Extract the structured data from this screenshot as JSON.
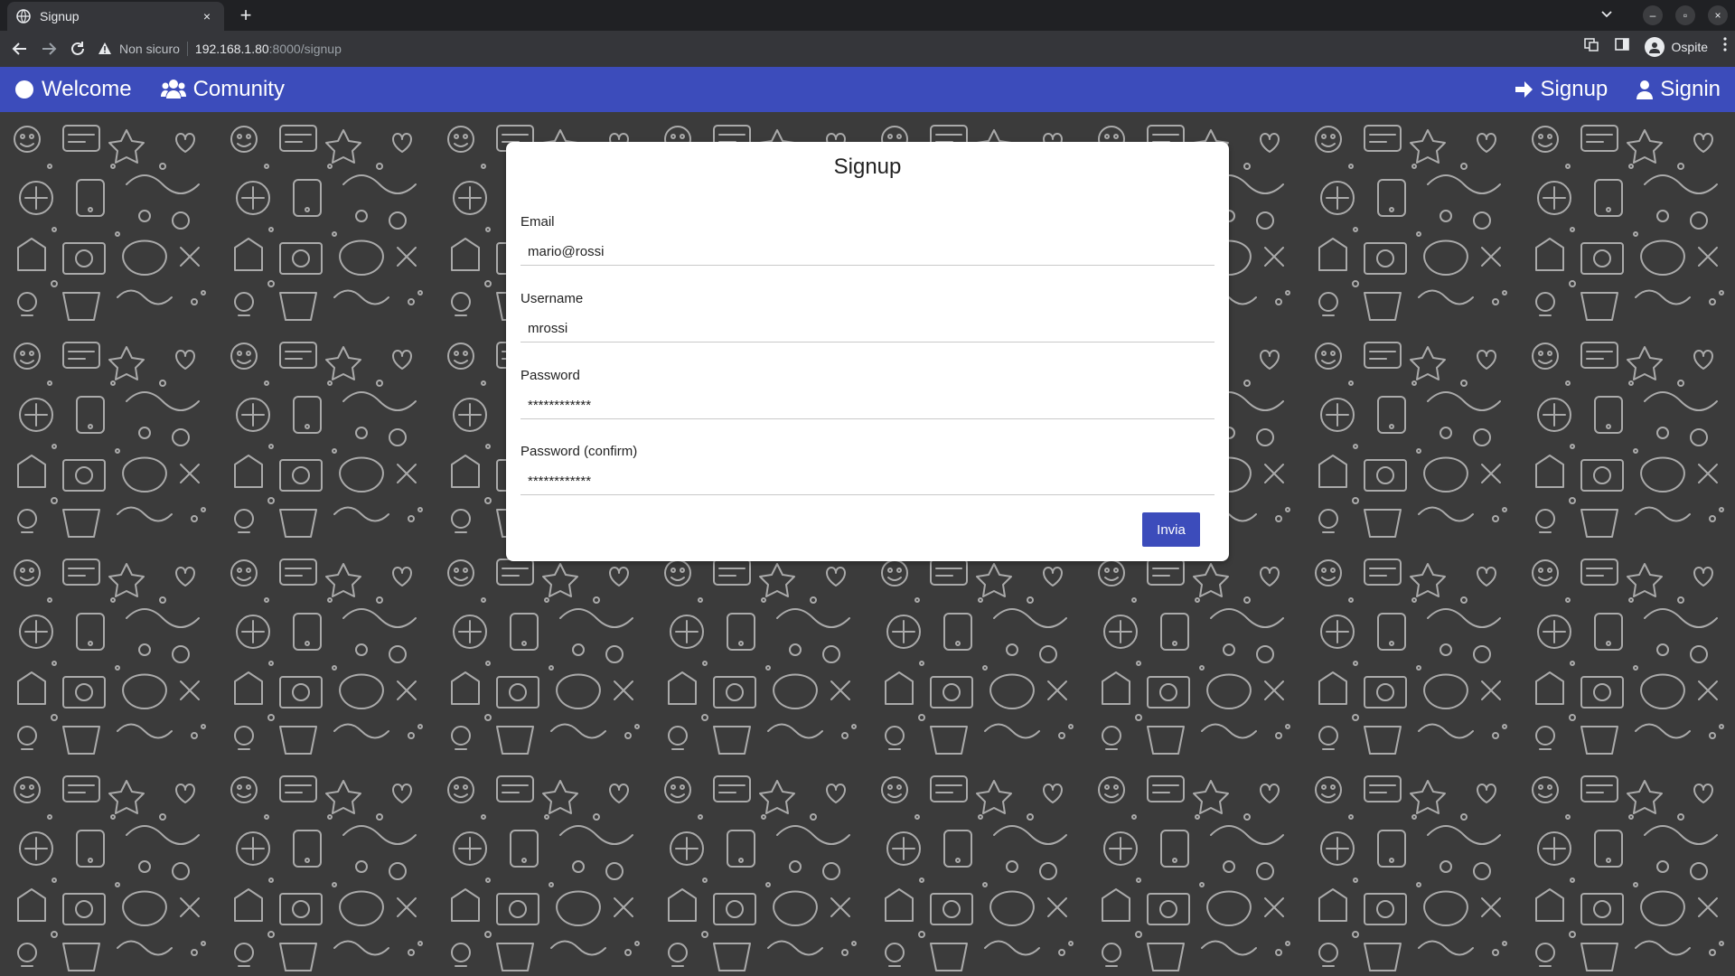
{
  "browser": {
    "tab_title": "Signup",
    "tab_close": "×",
    "new_tab": "+",
    "address": {
      "security_label": "Non sicuro",
      "host": "192.168.1.80",
      "path": ":8000/signup"
    },
    "profile_label": "Ospite",
    "window_controls": [
      "–",
      "▫",
      "×"
    ]
  },
  "navbar": {
    "left": [
      {
        "label": "Welcome",
        "icon": "circle-icon"
      },
      {
        "label": "Comunity",
        "icon": "users-icon"
      }
    ],
    "right": [
      {
        "label": "Signup",
        "icon": "arrow-right-icon"
      },
      {
        "label": "Signin",
        "icon": "user-icon"
      }
    ]
  },
  "form": {
    "title": "Signup",
    "fields": [
      {
        "label": "Email",
        "value": "mario@rossi",
        "type": "text"
      },
      {
        "label": "Username",
        "value": "mrossi",
        "type": "text"
      },
      {
        "label": "Password",
        "value": "************",
        "type": "password"
      },
      {
        "label": "Password (confirm)",
        "value": "************",
        "type": "password"
      }
    ],
    "submit_label": "Invia"
  },
  "colors": {
    "primary": "#3c4cbb",
    "background": "#3b3b3b",
    "chrome_dark": "#202124",
    "chrome_toolbar": "#35363a"
  }
}
